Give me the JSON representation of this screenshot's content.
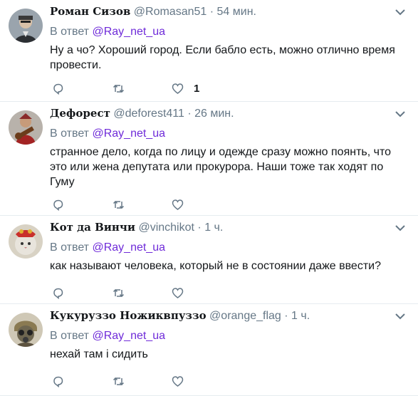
{
  "colors": {
    "accent": "#6f2bd9",
    "muted": "#657786",
    "divider": "#e6ecf0",
    "text": "#14171a"
  },
  "tweets": [
    {
      "name": "Роман Сизов",
      "handle": "@Romasan51",
      "dot": "·",
      "time": "54 мин.",
      "reply_prefix": "В ответ",
      "reply_mention": "@Ray_net_ua",
      "text": "Ну а чо? Хороший город. Если бабло есть, можно отлично время провести.",
      "like_count": "1",
      "icons": [
        "reply-icon",
        "retweet-icon",
        "heart-icon",
        "chevron-down-icon"
      ]
    },
    {
      "name": "Дефорест",
      "handle": "@deforest411",
      "dot": "·",
      "time": "26 мин.",
      "reply_prefix": "В ответ",
      "reply_mention": "@Ray_net_ua",
      "text": "странное  дело, когда по лицу и одежде сразу можно поянть, что это или жена депутата или прокурора. Наши тоже так ходят по Гуму",
      "like_count": "",
      "icons": [
        "reply-icon",
        "retweet-icon",
        "heart-icon",
        "chevron-down-icon"
      ]
    },
    {
      "name": "Кот да Винчи",
      "handle": "@vinchikot",
      "dot": "·",
      "time": "1 ч.",
      "reply_prefix": "В ответ",
      "reply_mention": "@Ray_net_ua",
      "text": "как называют человека, который не в состоянии даже ввести?",
      "like_count": "",
      "icons": [
        "reply-icon",
        "retweet-icon",
        "heart-icon",
        "chevron-down-icon"
      ]
    },
    {
      "name": "Кукуруззо Ножиквпуззо",
      "handle": "@orange_flag",
      "dot": "·",
      "time": "1 ч.",
      "reply_prefix": "В ответ",
      "reply_mention": "@Ray_net_ua",
      "text": "нехай там і сидить",
      "like_count": "",
      "icons": [
        "reply-icon",
        "retweet-icon",
        "heart-icon",
        "chevron-down-icon"
      ]
    }
  ]
}
